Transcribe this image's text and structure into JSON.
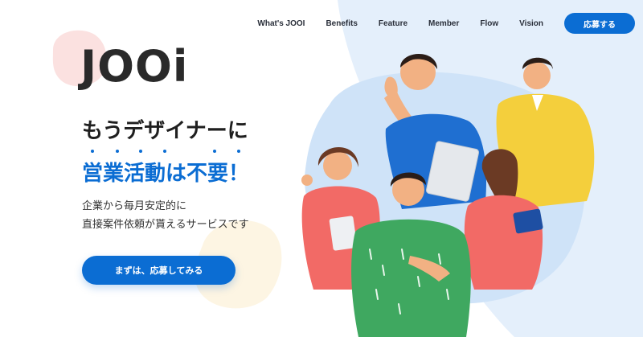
{
  "nav": {
    "items": [
      "What's JOOI",
      "Benefits",
      "Feature",
      "Member",
      "Flow",
      "Vision"
    ],
    "cta_label": "応募する"
  },
  "hero": {
    "logo": "JOOi",
    "headline_line1": "もうデザイナーに",
    "headline_line2": "営業活動は不要！",
    "description_line1": "企業から毎月安定的に",
    "description_line2": "直接案件依頼が貰えるサービスです",
    "cta_label": "まずは、応募してみる"
  },
  "colors": {
    "primary": "#0b6dd3",
    "sky_blob": "#e4effb",
    "pink_blob": "#fbe1e0",
    "cream_blob": "#fdf5e3"
  },
  "illustration": {
    "icons": [
      "designer-team-illustration"
    ]
  }
}
